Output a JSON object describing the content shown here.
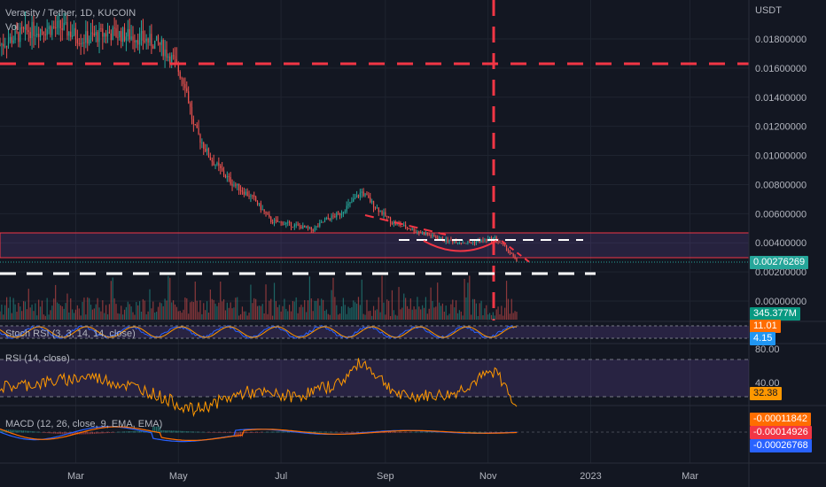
{
  "header": {
    "symbol": "Verasity / Tether",
    "interval": "1D",
    "exchange": "KUCOIN",
    "volume_label": "Vol",
    "currency": "USDT"
  },
  "price_axis": {
    "ticks": [
      "0.01800000",
      "0.01600000",
      "0.01400000",
      "0.01200000",
      "0.01000000",
      "0.00800000",
      "0.00600000",
      "0.00400000",
      "0.00200000",
      "0.00000000"
    ],
    "last_price": "0.00276269",
    "volume_value": "345.377M"
  },
  "stoch_rsi": {
    "title": "Stoch RSI (3, 3, 14, 14, close)",
    "k_value": "11.01",
    "d_value": "4.15"
  },
  "rsi": {
    "title": "RSI (14, close)",
    "level_80": "80.00",
    "level_40": "40.00",
    "value": "32.38"
  },
  "macd": {
    "title": "MACD (12, 26, close, 9, EMA, EMA)",
    "hist_value": "-0.00011842",
    "macd_value": "-0.00014926",
    "signal_value": "-0.00026768"
  },
  "time_axis": {
    "labels": [
      "Mar",
      "May",
      "Jul",
      "Sep",
      "Nov",
      "2023",
      "Mar"
    ]
  },
  "colors": {
    "background": "#131722",
    "up": "#26a69a",
    "down": "#ef5350",
    "dashed_red": "#f23645",
    "zone_fill": "#7e57c2",
    "rsi_line": "#ff9800",
    "macd_line": "#2962ff",
    "signal_line": "#ff6d00",
    "last_price_badge": "#26a69a",
    "volume_badge": "#089981"
  },
  "chart_data": {
    "type": "candlestick",
    "title": "Verasity / Tether, 1D, KUCOIN",
    "ylabel": "USDT",
    "ylim": [
      0.0,
      0.0195
    ],
    "x_range": [
      "2022-01-15",
      "2023-04-05"
    ],
    "price_path": [
      {
        "x": "2022-01-15",
        "y": 0.0176
      },
      {
        "x": "2022-02-01",
        "y": 0.0186
      },
      {
        "x": "2022-02-20",
        "y": 0.0188
      },
      {
        "x": "2022-03-05",
        "y": 0.018
      },
      {
        "x": "2022-03-20",
        "y": 0.0184
      },
      {
        "x": "2022-04-05",
        "y": 0.0182
      },
      {
        "x": "2022-04-20",
        "y": 0.0176
      },
      {
        "x": "2022-04-28",
        "y": 0.0165
      },
      {
        "x": "2022-05-05",
        "y": 0.015
      },
      {
        "x": "2022-05-10",
        "y": 0.012
      },
      {
        "x": "2022-05-20",
        "y": 0.0098
      },
      {
        "x": "2022-06-01",
        "y": 0.0082
      },
      {
        "x": "2022-06-15",
        "y": 0.007
      },
      {
        "x": "2022-06-25",
        "y": 0.0055
      },
      {
        "x": "2022-07-05",
        "y": 0.0053
      },
      {
        "x": "2022-07-20",
        "y": 0.0049
      },
      {
        "x": "2022-07-28",
        "y": 0.0056
      },
      {
        "x": "2022-08-05",
        "y": 0.006
      },
      {
        "x": "2022-08-18",
        "y": 0.0075
      },
      {
        "x": "2022-08-25",
        "y": 0.0066
      },
      {
        "x": "2022-09-05",
        "y": 0.0054
      },
      {
        "x": "2022-09-20",
        "y": 0.0048
      },
      {
        "x": "2022-10-05",
        "y": 0.0042
      },
      {
        "x": "2022-10-20",
        "y": 0.004
      },
      {
        "x": "2022-11-05",
        "y": 0.0043
      },
      {
        "x": "2022-11-12",
        "y": 0.0036
      },
      {
        "x": "2022-11-18",
        "y": 0.00276
      }
    ],
    "annotations": {
      "horizontal_dashed_red": 0.0163,
      "horizontal_dashed_white_low": 0.002,
      "horizontal_dashed_white_high": 0.0043,
      "vertical_dashed_red_date": "2022-11-05",
      "support_zone": [
        0.0029,
        0.0047
      ],
      "descending_trendline": [
        {
          "x": "2022-08-25",
          "y": 0.006
        },
        {
          "x": "2022-09-20",
          "y": 0.005
        }
      ]
    },
    "rsi_levels": [
      80,
      40
    ],
    "rsi_path": [
      {
        "x": "2022-01-15",
        "y": 50
      },
      {
        "x": "2022-02-10",
        "y": 55
      },
      {
        "x": "2022-03-10",
        "y": 62
      },
      {
        "x": "2022-04-10",
        "y": 48
      },
      {
        "x": "2022-05-10",
        "y": 25
      },
      {
        "x": "2022-06-10",
        "y": 45
      },
      {
        "x": "2022-07-10",
        "y": 40
      },
      {
        "x": "2022-08-05",
        "y": 55
      },
      {
        "x": "2022-08-18",
        "y": 78
      },
      {
        "x": "2022-09-10",
        "y": 40
      },
      {
        "x": "2022-10-10",
        "y": 42
      },
      {
        "x": "2022-11-05",
        "y": 68
      },
      {
        "x": "2022-11-18",
        "y": 32.38
      }
    ]
  }
}
